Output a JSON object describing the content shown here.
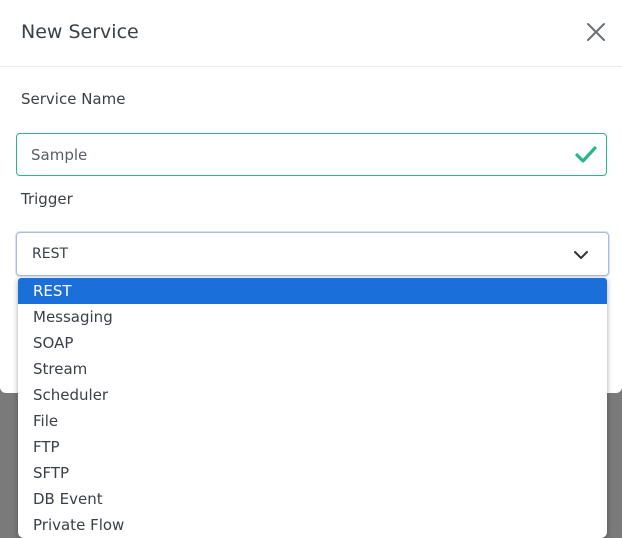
{
  "modal": {
    "title": "New Service"
  },
  "service_name": {
    "label": "Service Name",
    "value": "Sample",
    "valid": true
  },
  "trigger": {
    "label": "Trigger",
    "selected": "REST",
    "options": [
      "REST",
      "Messaging",
      "SOAP",
      "Stream",
      "Scheduler",
      "File",
      "FTP",
      "SFTP",
      "DB Event",
      "Private Flow"
    ]
  },
  "icons": {
    "close": "close-icon",
    "valid": "checkmark-icon",
    "dropdown": "chevron-down-icon"
  },
  "colors": {
    "valid_border": "#2bb58a",
    "selected_option": "#1a6fd8",
    "focus_border": "#a8bde3",
    "overlay": "#7a7a7a"
  }
}
